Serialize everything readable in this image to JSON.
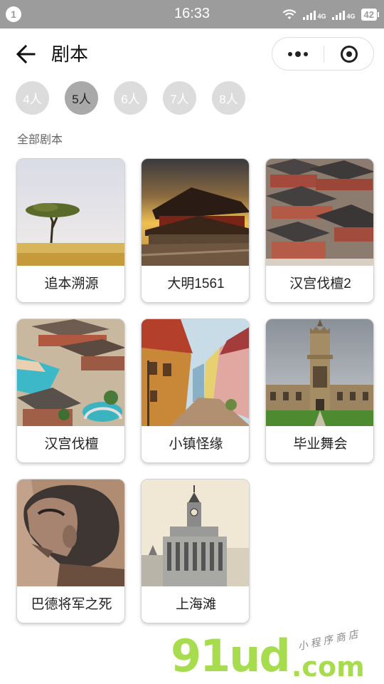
{
  "status_bar": {
    "notification_count": "1",
    "time": "16:33",
    "signal_1_label": "4G",
    "signal_2_label": "4G",
    "battery": "42"
  },
  "nav": {
    "title": "剧本",
    "back_icon": "arrow-left-icon",
    "more_icon": "more-dots-icon",
    "close_icon": "target-circle-icon"
  },
  "filters": [
    {
      "label": "4人",
      "selected": false
    },
    {
      "label": "5人",
      "selected": true
    },
    {
      "label": "6人",
      "selected": false
    },
    {
      "label": "7人",
      "selected": false
    },
    {
      "label": "8人",
      "selected": false
    }
  ],
  "section_title": "全部剧本",
  "scripts": [
    {
      "title": "追本溯源",
      "image": "savanna-acacia-tree"
    },
    {
      "title": "大明1561",
      "image": "ming-palace-sunset"
    },
    {
      "title": "汉宫伐檀2",
      "image": "han-palace-rooftops"
    },
    {
      "title": "汉宫伐檀",
      "image": "han-palace-model-waterway"
    },
    {
      "title": "小镇怪缘",
      "image": "painted-town-street"
    },
    {
      "title": "毕业舞会",
      "image": "college-tower-quad"
    },
    {
      "title": "巴德将军之死",
      "image": "sketched-old-man-portrait"
    },
    {
      "title": "上海滩",
      "image": "shanghai-bund-clocktower"
    }
  ],
  "watermark": {
    "main": "91ud",
    "suffix": ".com",
    "tagline": "小程序商店"
  },
  "colors": {
    "status_bar_bg": "#9c9c9c",
    "chip_inactive": "#dcdcdc",
    "chip_active": "#a9a9a9",
    "watermark_green": "#a7dc4e"
  }
}
